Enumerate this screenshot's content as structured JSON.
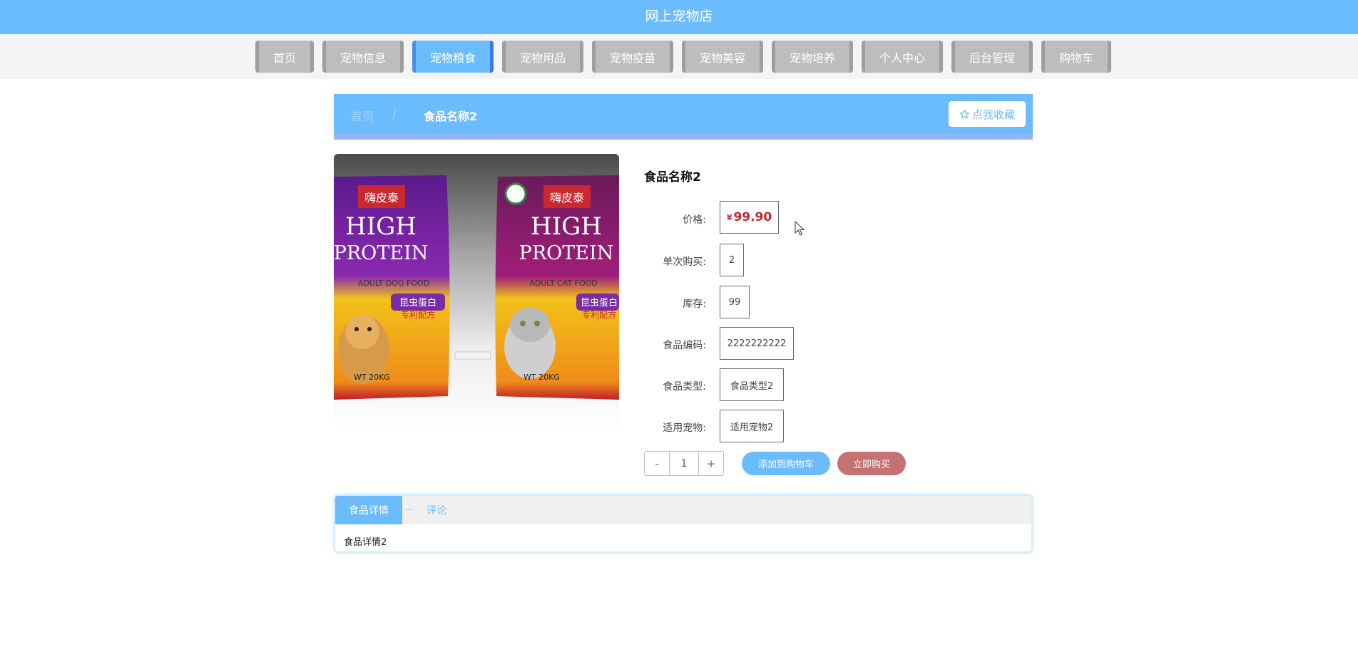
{
  "site": {
    "title": "网上宠物店"
  },
  "nav": {
    "items": [
      {
        "label": "首页"
      },
      {
        "label": "宠物信息"
      },
      {
        "label": "宠物粮食",
        "active": true
      },
      {
        "label": "宠物用品"
      },
      {
        "label": "宠物疫苗"
      },
      {
        "label": "宠物美容"
      },
      {
        "label": "宠物培养"
      },
      {
        "label": "个人中心"
      },
      {
        "label": "后台管理"
      },
      {
        "label": "购物车"
      }
    ]
  },
  "breadcrumb": {
    "home": "首页",
    "separator": "/",
    "current": "食品名称2"
  },
  "favorite": {
    "icon": "star-outline-icon",
    "label": "点我收藏"
  },
  "product_image": {
    "left_bag": {
      "brand": "嗨皮泰",
      "line1": "HIGH",
      "line2": "PROTEIN",
      "type": "ADULT DOG FOOD",
      "badge": "昆虫蛋白",
      "badge2": "专利配方",
      "weight": "WT 20KG"
    },
    "right_bag": {
      "brand": "嗨皮泰",
      "line1": "HIGH",
      "line2": "PROTEIN",
      "type": "ADULT CAT FOOD",
      "badge": "昆虫蛋白",
      "badge2": "专利配方",
      "weight": "WT 20KG"
    }
  },
  "product": {
    "name": "食品名称2",
    "price_label": "价格:",
    "currency": "¥",
    "price": "99.90",
    "limit_label": "单次购买:",
    "limit": "2",
    "stock_label": "库存:",
    "stock": "99",
    "code_label": "食品编码:",
    "code": "2222222222",
    "type_label": "食品类型:",
    "type": "食品类型2",
    "pet_label": "适用宠物:",
    "pet": "适用宠物2"
  },
  "quantity": {
    "minus": "-",
    "value": "1",
    "plus": "+"
  },
  "actions": {
    "add_to_cart": "添加到购物车",
    "buy_now": "立即购买"
  },
  "tabs": {
    "detail": "食品详情",
    "comments": "评论",
    "content": "食品详情2"
  },
  "colors": {
    "primary": "#6bbcfc",
    "price": "#c7262c",
    "buy": "#c57273"
  }
}
